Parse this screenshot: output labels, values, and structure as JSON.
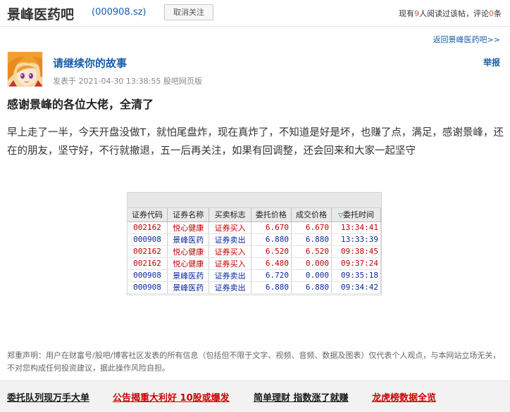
{
  "header": {
    "bar_name": "景峰医药吧",
    "stock_code": "(000908.sz)",
    "unfollow_label": "取消关注",
    "readers_prefix": "现有",
    "readers_count": "9",
    "readers_middle": "人阅读过该帖，评论",
    "comment_count": "0",
    "readers_suffix": "条"
  },
  "nav": {
    "back_label": "返回景峰医药吧>>"
  },
  "post": {
    "title": "请继续你的故事",
    "report_label": "举报",
    "meta": "发表于 2021-04-30 13:38:55 股吧网页版",
    "headline": "感谢景峰的各位大佬，全清了",
    "body": "早上走了一半，今天开盘没做T，就怕尾盘炸，现在真炸了，不知道是好是坏，也赚了点，满足，感谢景峰，还在的朋友，坚守好，不行就撤退，五一后再关注，如果有回调整，还会回来和大家一起坚守"
  },
  "trades": {
    "headers": [
      "证券代码",
      "证券名称",
      "买卖标志",
      "委托价格",
      "成交价格",
      "委托时间"
    ],
    "sort_icon": "sort-triangle-icon",
    "rows": [
      {
        "code": "002162",
        "name": "悦心健康",
        "flag": "证券买入",
        "order_price": "6.670",
        "deal_price": "6.670",
        "time": "13:34:41",
        "side": "buy"
      },
      {
        "code": "000908",
        "name": "景峰医药",
        "flag": "证券卖出",
        "order_price": "6.880",
        "deal_price": "6.880",
        "time": "13:33:39",
        "side": "sell"
      },
      {
        "code": "002162",
        "name": "悦心健康",
        "flag": "证券买入",
        "order_price": "6.520",
        "deal_price": "6.520",
        "time": "09:38:45",
        "side": "buy"
      },
      {
        "code": "002162",
        "name": "悦心健康",
        "flag": "证券买入",
        "order_price": "6.480",
        "deal_price": "0.000",
        "time": "09:37:24",
        "side": "buy"
      },
      {
        "code": "000908",
        "name": "景峰医药",
        "flag": "证券卖出",
        "order_price": "6.720",
        "deal_price": "0.000",
        "time": "09:35:18",
        "side": "sell"
      },
      {
        "code": "000908",
        "name": "景峰医药",
        "flag": "证券卖出",
        "order_price": "6.880",
        "deal_price": "6.880",
        "time": "09:34:42",
        "side": "sell"
      }
    ],
    "colors": {
      "buy": "#c00000",
      "sell": "#0a2a9a"
    }
  },
  "disclaimer": "郑重声明：用户在财富号/股吧/博客社区发表的所有信息（包括但不限于文字、视频、音频、数据及图表）仅代表个人观点，与本网站立场无关，不对您构成任何投资建议，据此操作风险自担。",
  "footer": {
    "links": [
      {
        "label": "委托队列现万手大单",
        "color": "#1a1a1a"
      },
      {
        "label": "公告揭重大利好 10股或爆发",
        "color": "#d00000"
      },
      {
        "label": "简单理财 指数涨了就赚",
        "color": "#1a1a1a"
      },
      {
        "label": "龙虎榜数据全览",
        "color": "#d00000"
      }
    ]
  }
}
